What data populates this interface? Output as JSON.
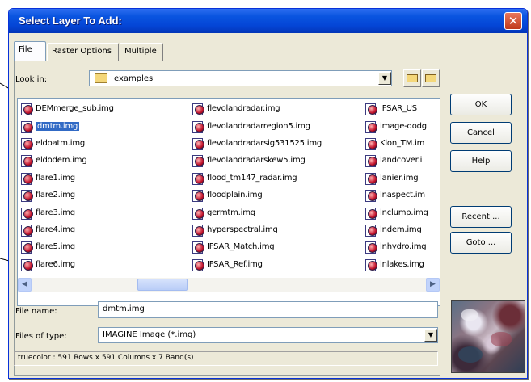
{
  "dialog": {
    "title": "Select Layer To Add:",
    "close_glyph": "✕"
  },
  "tabs": [
    {
      "label": "File",
      "active": true
    },
    {
      "label": "Raster Options",
      "active": false
    },
    {
      "label": "Multiple",
      "active": false
    }
  ],
  "look_in": {
    "label": "Look in:",
    "value": "examples",
    "dropdown_glyph": "▼"
  },
  "files": {
    "columns": [
      [
        "DEMmerge_sub.img",
        "dmtm.img",
        "eldoatm.img",
        "eldodem.img",
        "flare1.img",
        "flare2.img",
        "flare3.img",
        "flare4.img",
        "flare5.img",
        "flare6.img"
      ],
      [
        "flevolandradar.img",
        "flevolandradarregion5.img",
        "flevolandradarsig531525.img",
        "flevolandradarskew5.img",
        "flood_tm147_radar.img",
        "floodplain.img",
        "germtm.img",
        "hyperspectral.img",
        "IFSAR_Match.img",
        "IFSAR_Ref.img"
      ],
      [
        "IFSAR_US",
        "image-dodg",
        "Klon_TM.im",
        "landcover.i",
        "lanier.img",
        "lnaspect.im",
        "lnclump.img",
        "lndem.img",
        "lnhydro.img",
        "lnlakes.img"
      ]
    ],
    "selected": "dmtm.img"
  },
  "scroll": {
    "left_glyph": "◀",
    "right_glyph": "▶"
  },
  "buttons": {
    "ok": "OK",
    "cancel": "Cancel",
    "help": "Help",
    "recent": "Recent ...",
    "goto": "Goto ..."
  },
  "file_name": {
    "label": "File name:",
    "value": "dmtm.img"
  },
  "files_of_type": {
    "label": "Files of type:",
    "value": "IMAGINE Image (*.img)",
    "dropdown_glyph": "▼"
  },
  "status": "truecolor : 591 Rows x 591 Columns x 7 Band(s)"
}
